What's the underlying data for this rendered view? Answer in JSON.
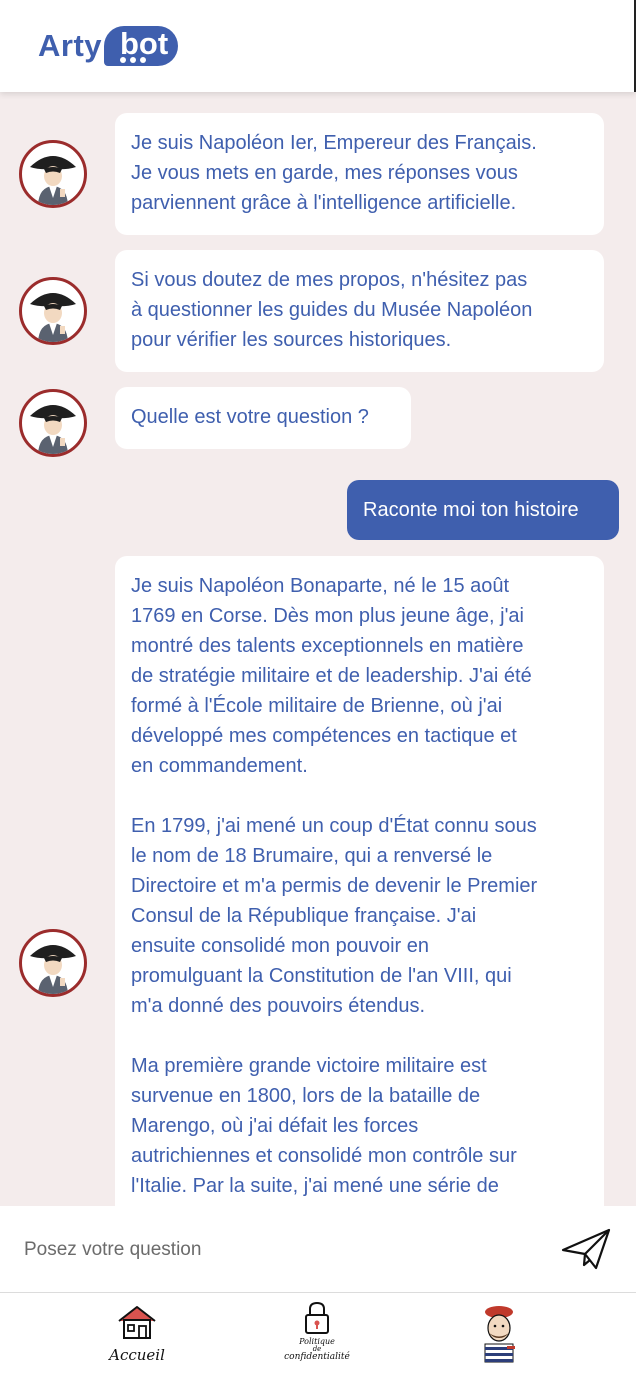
{
  "brand": {
    "name_part1": "Arty",
    "name_part2": "bot",
    "primary_color": "#3f5fae",
    "accent_color": "#9b2c2c"
  },
  "conversation": {
    "bot_avatar_icon": "napoleon-avatar-icon",
    "messages": [
      {
        "from": "bot",
        "text": "Je suis Napoléon Ier, Empereur des Français.\nJe vous mets en garde, mes réponses vous\nparviennent grâce à l'intelligence artificielle."
      },
      {
        "from": "bot",
        "text": "Si vous doutez de mes propos, n'hésitez pas\nà questionner les guides du Musée Napoléon\npour vérifier les sources historiques."
      },
      {
        "from": "bot",
        "text": "Quelle est votre question ?"
      },
      {
        "from": "user",
        "text": "Raconte moi ton histoire"
      },
      {
        "from": "bot",
        "text": "Je suis Napoléon Bonaparte, né le 15 août\n1769 en Corse. Dès mon plus jeune âge, j'ai\nmontré des talents exceptionnels en matière\nde stratégie militaire et de leadership. J'ai été\nformé à l'École militaire de Brienne, où j'ai\ndéveloppé mes compétences en tactique et\nen commandement.\n\nEn 1799, j'ai mené un coup d'État connu sous\nle nom de 18 Brumaire, qui a renversé le\nDirectoire et m'a permis de devenir le Premier\nConsul de la République française. J'ai\nensuite consolidé mon pouvoir en\npromulguant la Constitution de l'an VIII, qui\nm'a donné des pouvoirs étendus.\n\nMa première grande victoire militaire est\nsurvenue en 1800, lors de la bataille de\nMarengo, où j'ai défait les forces\nautrichiennes et consolidé mon contrôle sur\nl'Italie. Par la suite, j'ai mené une série de"
      }
    ]
  },
  "composer": {
    "placeholder": "Posez votre question",
    "value": "",
    "send_icon": "paper-plane-icon"
  },
  "bottom_nav": {
    "items": [
      {
        "label": "Accueil",
        "icon": "house-icon"
      },
      {
        "label_line1": "Politique",
        "label_line2": "de",
        "label_line3": "confidentialité",
        "icon": "padlock-icon"
      },
      {
        "label": "",
        "icon": "artist-avatar-icon"
      }
    ]
  }
}
